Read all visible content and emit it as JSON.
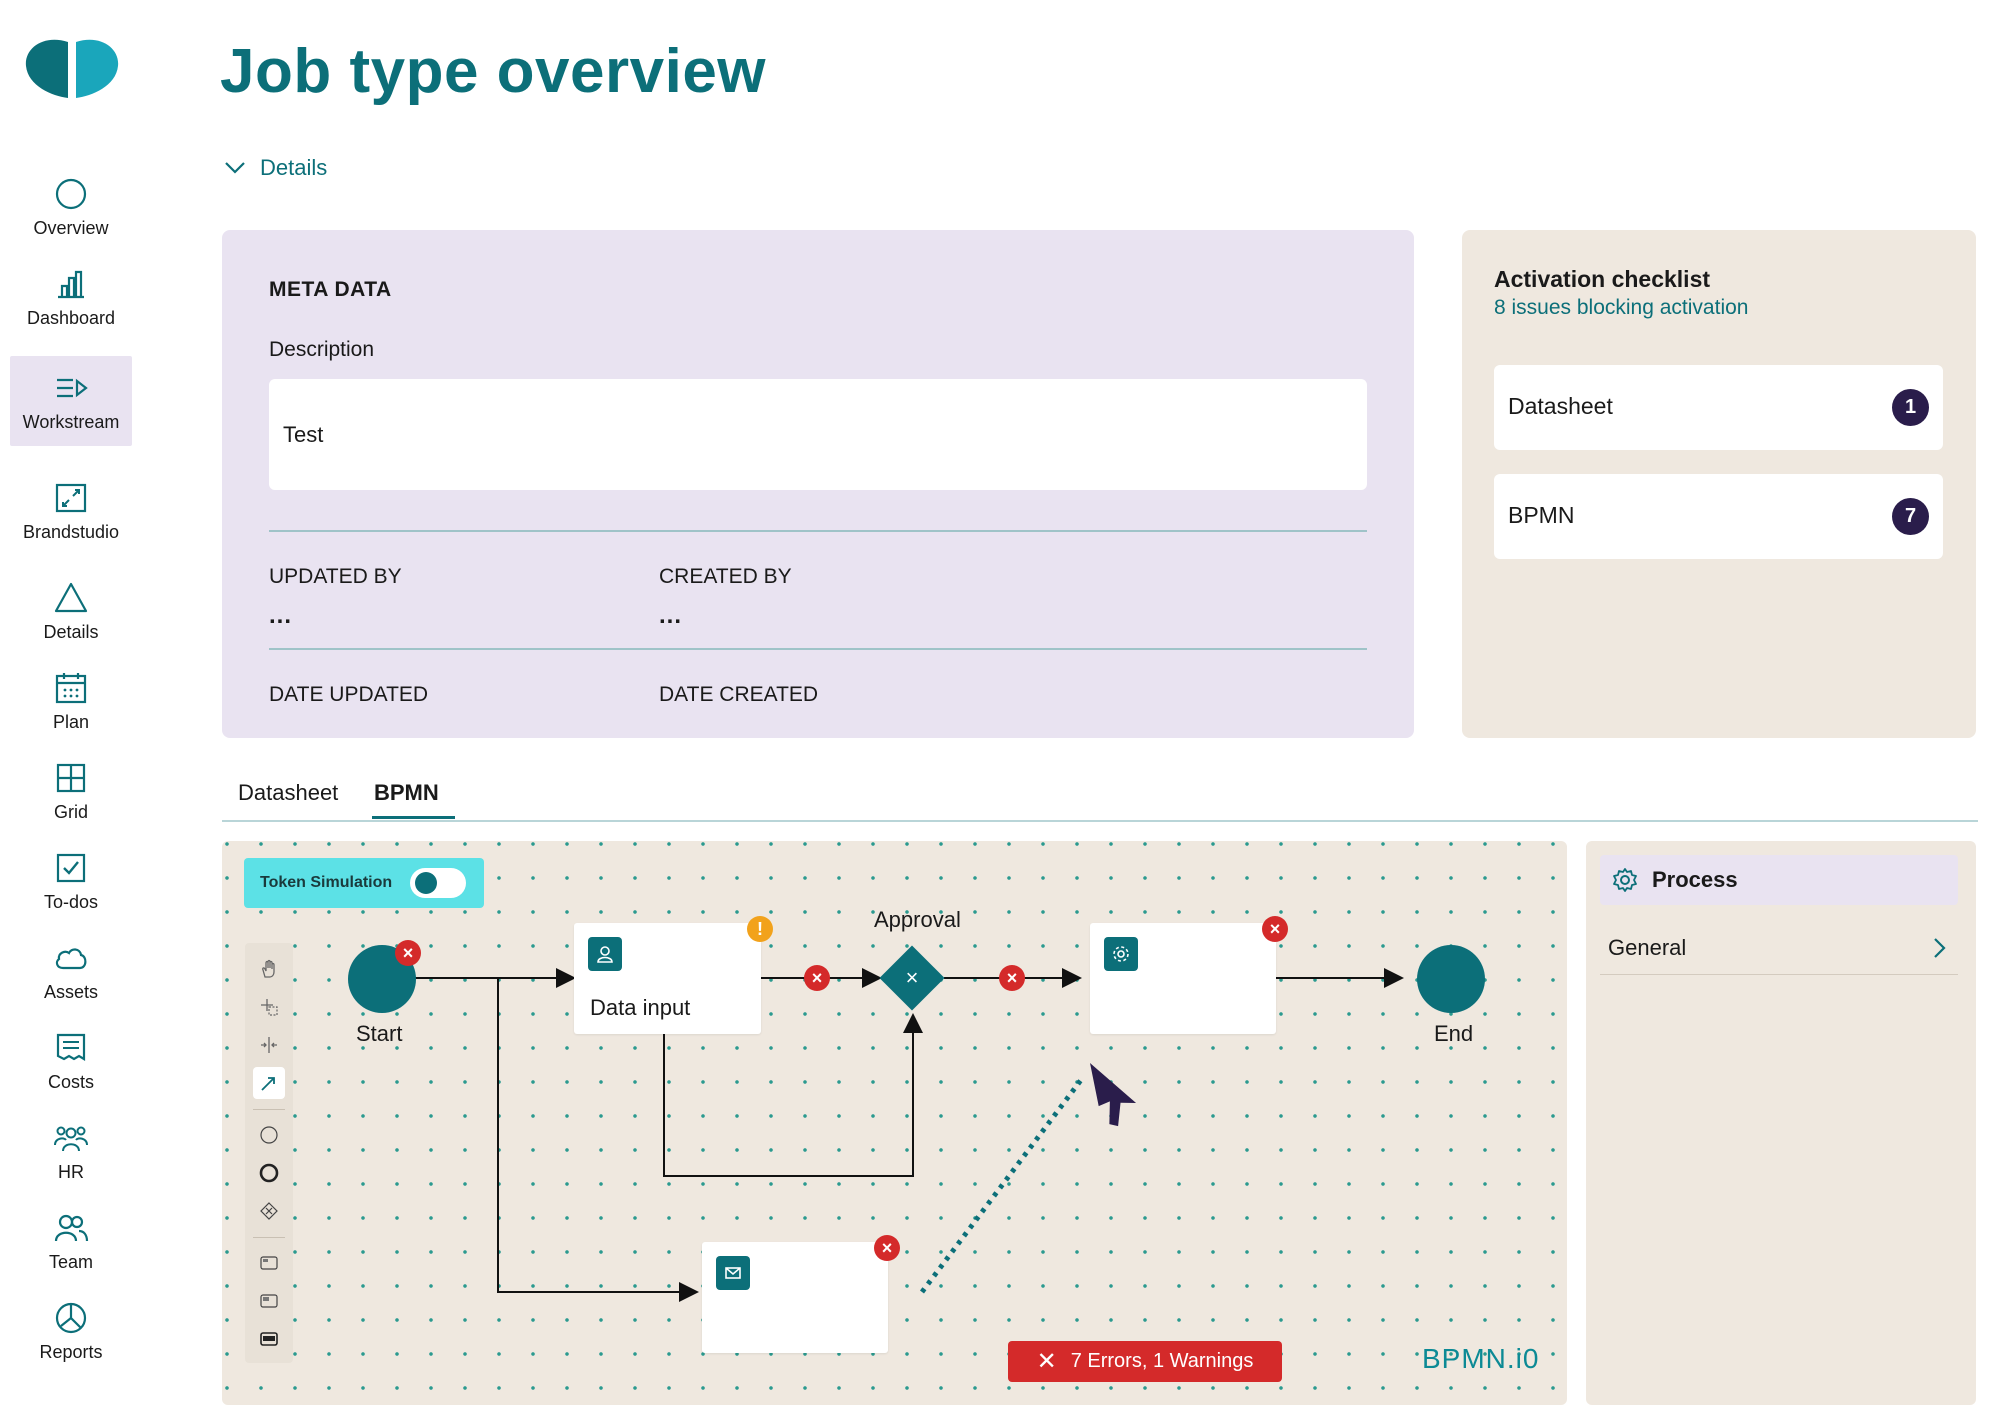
{
  "sidebar": {
    "items": [
      {
        "label": "Overview",
        "icon": "circle-icon"
      },
      {
        "label": "Dashboard",
        "icon": "bar-chart-icon"
      },
      {
        "label": "Workstream",
        "icon": "workstream-icon"
      },
      {
        "label": "Brandstudio",
        "icon": "expand-icon"
      },
      {
        "label": "Details",
        "icon": "triangle-icon"
      },
      {
        "label": "Plan",
        "icon": "calendar-icon"
      },
      {
        "label": "Grid",
        "icon": "grid-icon"
      },
      {
        "label": "To-dos",
        "icon": "checkbox-icon"
      },
      {
        "label": "Assets",
        "icon": "cloud-icon"
      },
      {
        "label": "Costs",
        "icon": "receipt-icon"
      },
      {
        "label": "HR",
        "icon": "people-group-icon"
      },
      {
        "label": "Team",
        "icon": "team-icon"
      },
      {
        "label": "Reports",
        "icon": "pie-chart-icon"
      }
    ],
    "active": "Workstream"
  },
  "header": {
    "title": "Job type overview",
    "details_toggle": "Details"
  },
  "meta": {
    "title": "META DATA",
    "description_label": "Description",
    "description_value": "Test",
    "updated_by_label": "UPDATED BY",
    "updated_by_value": "...",
    "created_by_label": "CREATED BY",
    "created_by_value": "...",
    "date_updated_label": "DATE UPDATED",
    "date_created_label": "DATE CREATED"
  },
  "checklist": {
    "title": "Activation checklist",
    "subtitle": "8 issues blocking activation",
    "items": [
      {
        "label": "Datasheet",
        "count": "1"
      },
      {
        "label": "BPMN",
        "count": "7"
      }
    ]
  },
  "tabs": {
    "items": [
      "Datasheet",
      "BPMN"
    ],
    "active": "BPMN"
  },
  "bpmn": {
    "token_simulation_label": "Token Simulation",
    "token_simulation_on": false,
    "start_label": "Start",
    "data_input_label": "Data input",
    "approval_label": "Approval",
    "end_label": "End",
    "errors_badge": "7 Errors, 1 Warnings",
    "watermark": "BPMN.i0",
    "colors": {
      "accent": "#0c6f79",
      "error": "#d42a2a",
      "warning": "#f2a21b",
      "token_bg": "#5ce1e6",
      "canvas_bg": "#efe8df",
      "meta_bg": "#e9e3f1",
      "badge_bg": "#2a1d4b"
    }
  },
  "properties": {
    "title": "Process",
    "general_label": "General"
  }
}
